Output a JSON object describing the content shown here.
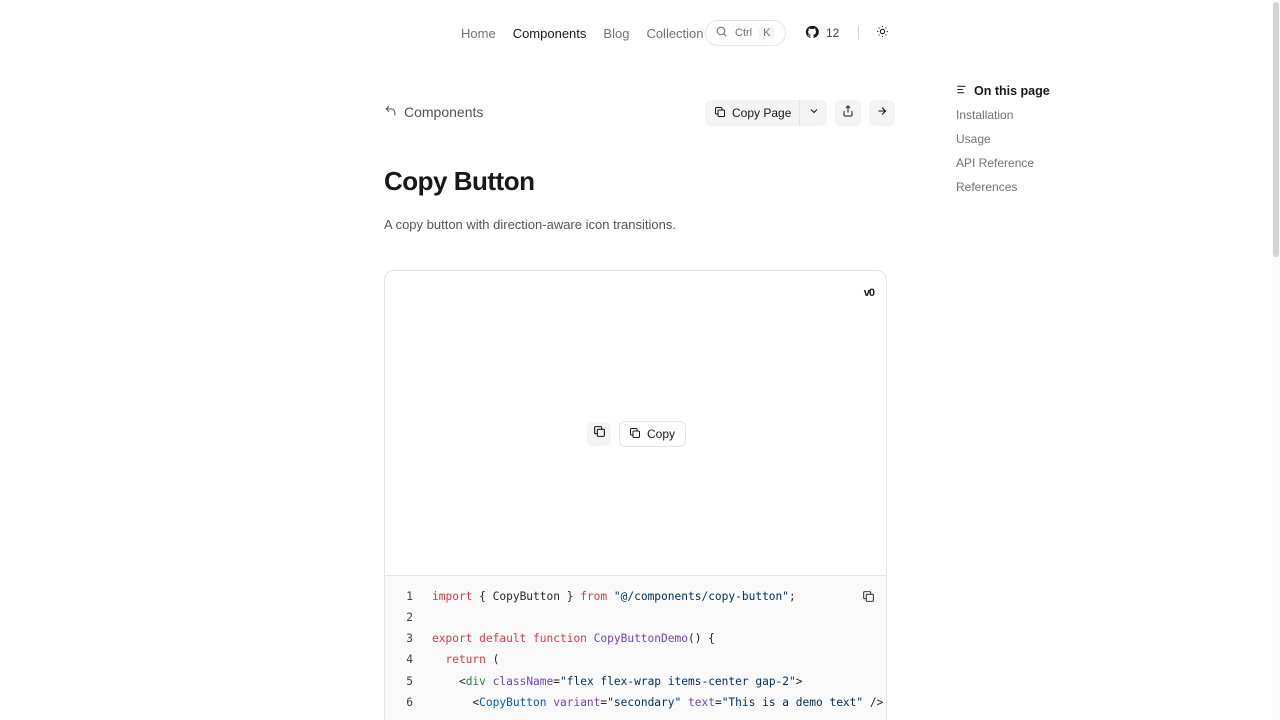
{
  "nav": {
    "links": [
      "Home",
      "Components",
      "Blog",
      "Collection"
    ],
    "active_index": 1,
    "search": {
      "ctrl": "Ctrl",
      "key": "K"
    },
    "github_stars": "12"
  },
  "breadcrumb": {
    "back_label": "Components"
  },
  "actions": {
    "copy_page_label": "Copy Page"
  },
  "page": {
    "title": "Copy Button",
    "description": "A copy button with direction-aware icon transitions."
  },
  "preview": {
    "badge": "v0",
    "demo_copy_label": "Copy"
  },
  "code": {
    "line_numbers": [
      "1",
      "2",
      "3",
      "4",
      "5",
      "6"
    ],
    "l1": {
      "kw1": "import",
      "body": " { CopyButton } ",
      "kw2": "from",
      "str": " \"@/components/copy-button\"",
      "end": ";"
    },
    "l3": {
      "kw": "export default function",
      "fn": " CopyButtonDemo",
      "end": "() {"
    },
    "l4": {
      "kw": "  return",
      "end": " ("
    },
    "l5": {
      "open": "    <",
      "tag": "div",
      "attr": " className",
      "eq": "=",
      "str": "\"flex flex-wrap items-center gap-2\"",
      "end": ">"
    },
    "l6": {
      "open": "      <",
      "comp": "CopyButton",
      "attr1": " variant",
      "eq1": "=",
      "str1": "\"secondary\"",
      "attr2": " text",
      "eq2": "=",
      "str2": "\"This is a demo text\"",
      "end": " />"
    }
  },
  "toc": {
    "title": "On this page",
    "items": [
      "Installation",
      "Usage",
      "API Reference",
      "References"
    ]
  },
  "colors": {
    "accent": "#18181b",
    "muted": "#71717a",
    "border": "#e4e4e7"
  }
}
